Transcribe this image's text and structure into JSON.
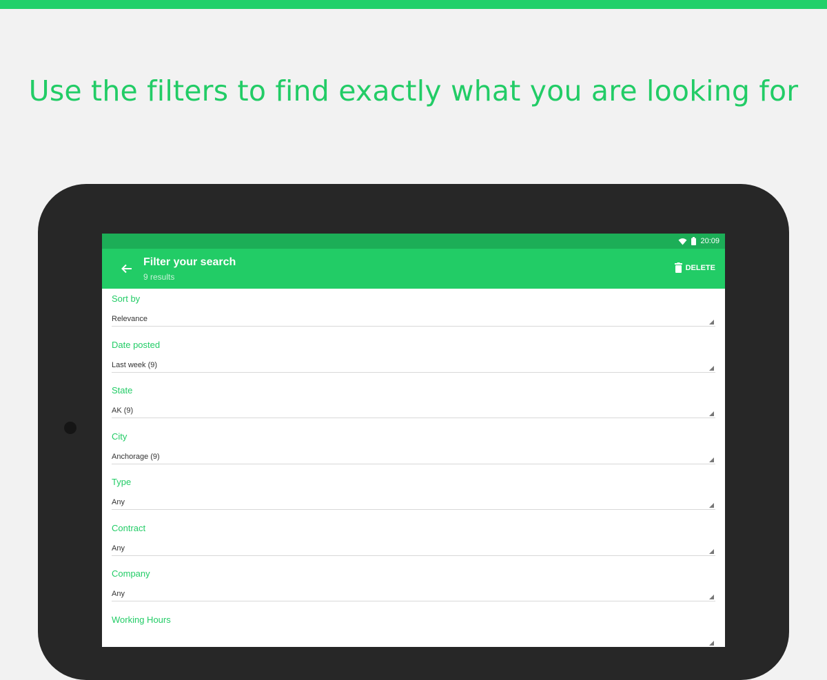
{
  "headline": "Use the filters to find exactly what you are looking for",
  "colors": {
    "accent": "#22cc66",
    "status_bar": "#1cae57",
    "tablet_frame": "#272727",
    "background": "#f2f2f2"
  },
  "status_bar": {
    "time": "20:09",
    "icons": [
      "wifi-icon",
      "battery-icon"
    ]
  },
  "appbar": {
    "back_icon": "arrow-left-icon",
    "title": "Filter your search",
    "subtitle": "9 results",
    "delete_icon": "trash-icon",
    "delete_label": "DELETE"
  },
  "filters": [
    {
      "label": "Sort by",
      "value": "Relevance"
    },
    {
      "label": "Date posted",
      "value": "Last week (9)"
    },
    {
      "label": "State",
      "value": "AK (9)"
    },
    {
      "label": "City",
      "value": "Anchorage (9)"
    },
    {
      "label": "Type",
      "value": "Any"
    },
    {
      "label": "Contract",
      "value": "Any"
    },
    {
      "label": "Company",
      "value": "Any"
    },
    {
      "label": "Working Hours",
      "value": ""
    }
  ]
}
